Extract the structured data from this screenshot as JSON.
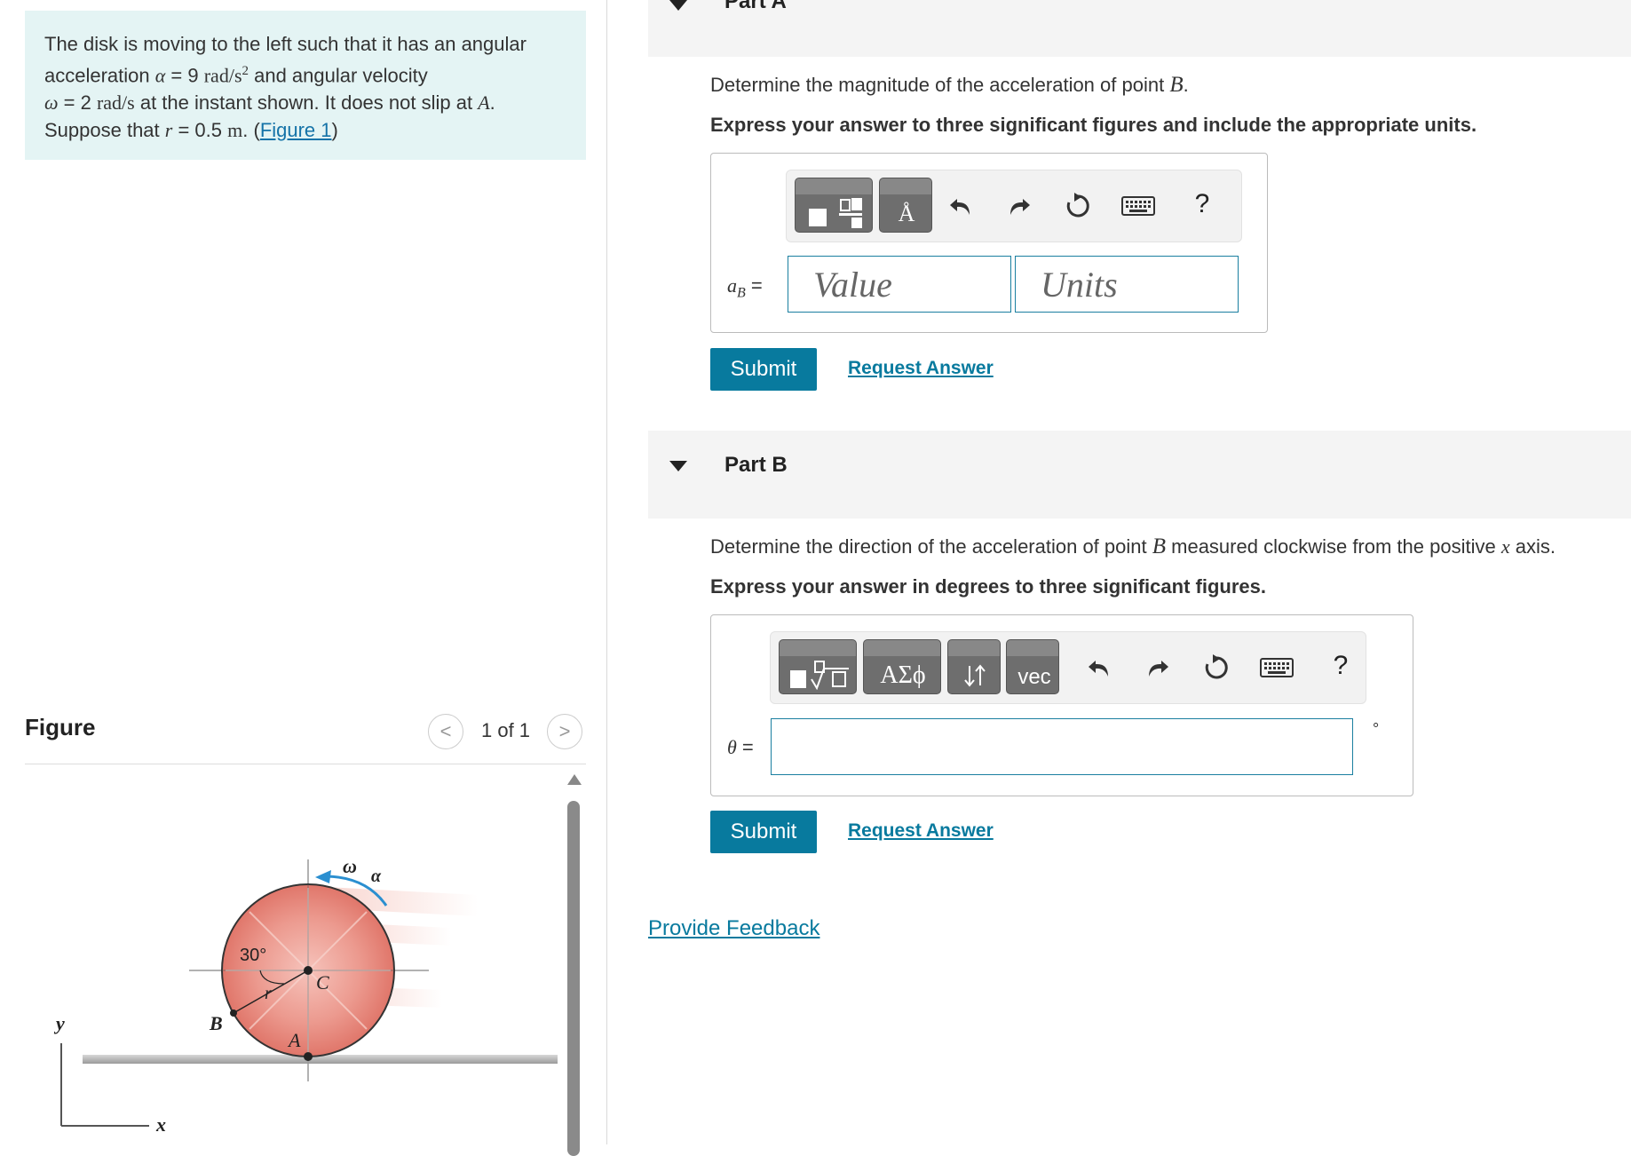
{
  "problem": {
    "line1": "The disk is moving to the left such that it has an angular",
    "line2_a": "acceleration ",
    "alpha_sym": "α",
    "line2_b": " = 9 ",
    "line2_unit": "rad/s",
    "line2_sup": "2",
    "line2_c": " and angular velocity",
    "omega_sym": "ω",
    "line3_a": " = 2 ",
    "line3_unit": "rad/s",
    "line3_b": " at the instant shown. It does not slip at ",
    "line3_A": "A",
    "line3_dot": ".",
    "line4_a": "Suppose that ",
    "line4_r": "r",
    "line4_b": " = 0.5 ",
    "line4_unit": "m",
    "line4_c": ". (",
    "figure_link": "Figure 1",
    "line4_d": ")"
  },
  "figure": {
    "title": "Figure",
    "pager": "1 of 1",
    "prev": "<",
    "next": ">",
    "labels": {
      "omega": "ω",
      "alpha": "α",
      "angle": "30°",
      "r": "r",
      "C": "C",
      "B": "B",
      "A": "A",
      "y": "y",
      "x": "x"
    }
  },
  "partA": {
    "label": "Part A",
    "question_pre": "Determine the magnitude of the acceleration of point ",
    "question_var": "B",
    "question_post": ".",
    "instruction": "Express your answer to three significant figures and include the appropriate units.",
    "eq_label_var": "a",
    "eq_label_sub": "B",
    "eq_label_eq": " =",
    "value_placeholder": "Value",
    "units_placeholder": "Units",
    "unit_btn_glyph": "Å",
    "help": "?",
    "submit": "Submit",
    "request": "Request Answer"
  },
  "partB": {
    "label": "Part B",
    "question_pre": "Determine the direction of the acceleration of point ",
    "question_var": "B",
    "question_mid": " measured clockwise from the positive ",
    "question_x": "x",
    "question_post": " axis.",
    "instruction": "Express your answer in degrees to three significant figures.",
    "eq_label": "θ",
    "eq_eq": " =",
    "degree": "°",
    "greek_btn": "ΑΣϕ",
    "vec_btn": "vec",
    "help": "?",
    "submit": "Submit",
    "request": "Request Answer"
  },
  "feedback": "Provide Feedback",
  "colors": {
    "accent": "#087a9e",
    "problem_bg": "#e4f4f4",
    "disk": "#e8837a"
  }
}
